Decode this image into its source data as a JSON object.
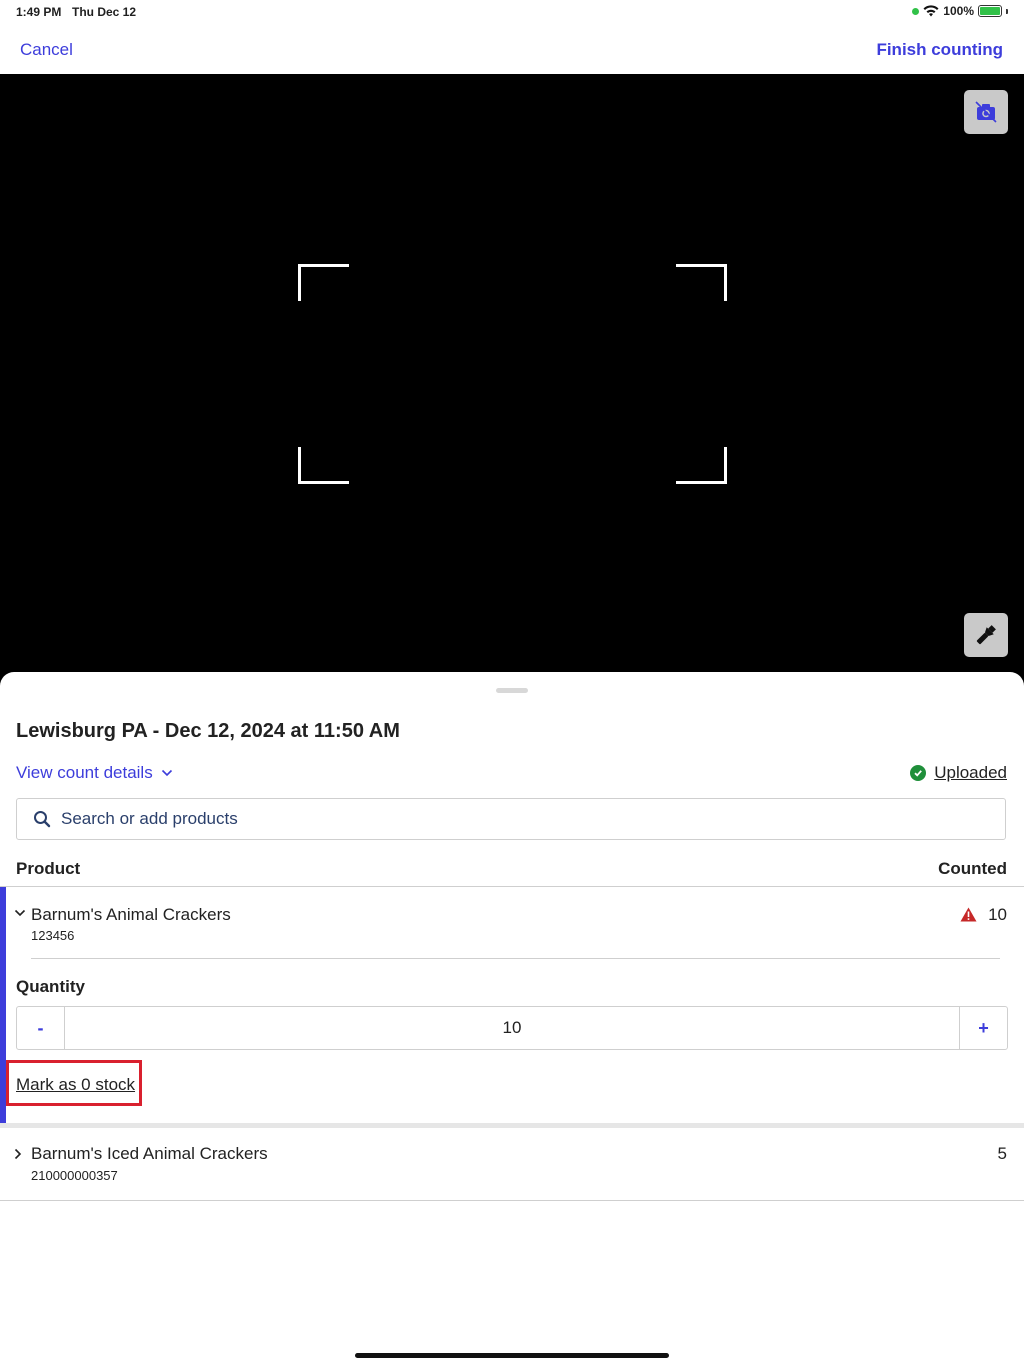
{
  "status_bar": {
    "time": "1:49 PM",
    "date": "Thu Dec 12",
    "battery": "100%"
  },
  "nav": {
    "cancel_label": "Cancel",
    "finish_label": "Finish counting"
  },
  "count": {
    "title": "Lewisburg PA - Dec 12, 2024 at 11:50 AM",
    "view_details_label": "View count details",
    "status_label": "Uploaded"
  },
  "search": {
    "placeholder": "Search or add products"
  },
  "table": {
    "col_product": "Product",
    "col_counted": "Counted",
    "rows": [
      {
        "name": "Barnum's Animal Crackers",
        "sku": "123456",
        "counted": "10",
        "expanded": true,
        "quantity_label": "Quantity",
        "quantity_value": "10",
        "minus_label": "-",
        "plus_label": "+",
        "mark_zero_label": "Mark as 0 stock"
      },
      {
        "name": "Barnum's Iced Animal Crackers",
        "sku": "210000000357",
        "counted": "5",
        "expanded": false
      }
    ]
  },
  "colors": {
    "accent": "#3d3ddb",
    "success": "#1f8f3a",
    "warning": "#c62828",
    "highlight": "#d9202e"
  }
}
